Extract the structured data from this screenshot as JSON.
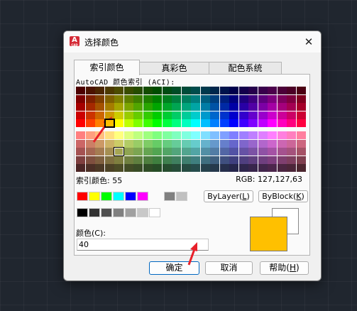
{
  "window": {
    "title": "选择颜色",
    "close_glyph": "✕",
    "app_icon_letter": "A",
    "app_icon_sub": "CAD"
  },
  "tabs": [
    {
      "label": "索引颜色",
      "active": true
    },
    {
      "label": "真彩色",
      "active": false
    },
    {
      "label": "配色系统",
      "active": false
    }
  ],
  "aci": {
    "title": "AutoCAD 颜色索引 (ACI):",
    "index_label": "索引颜色: 55",
    "rgb_label": "RGB:  127,127,63",
    "selected_index": 55,
    "hover_index": 57,
    "top_rows": [
      [
        "#4c0000",
        "#4c1300",
        "#4c2600",
        "#4c3900",
        "#4c4c00",
        "#394c00",
        "#264c00",
        "#134c00",
        "#004c00",
        "#004c13",
        "#004c26",
        "#004c39",
        "#004c4c",
        "#00394c",
        "#00264c",
        "#00134c",
        "#00004c",
        "#13004c",
        "#26004c",
        "#39004c",
        "#4c004c",
        "#4c0039",
        "#4c0026",
        "#4c0013"
      ],
      [
        "#7f0000",
        "#7f1f00",
        "#7f3f00",
        "#7f5f00",
        "#7f7f00",
        "#5f7f00",
        "#3f7f00",
        "#1f7f00",
        "#007f00",
        "#007f1f",
        "#007f3f",
        "#007f5f",
        "#007f7f",
        "#005f7f",
        "#003f7f",
        "#001f7f",
        "#00007f",
        "#1f007f",
        "#3f007f",
        "#5f007f",
        "#7f007f",
        "#7f005f",
        "#7f003f",
        "#7f001f"
      ],
      [
        "#a50000",
        "#a52900",
        "#a55200",
        "#a57c00",
        "#a5a500",
        "#7ca500",
        "#52a500",
        "#29a500",
        "#00a500",
        "#00a529",
        "#00a552",
        "#00a57c",
        "#00a5a5",
        "#007ca5",
        "#0052a5",
        "#0029a5",
        "#0000a5",
        "#2900a5",
        "#5200a5",
        "#7c00a5",
        "#a500a5",
        "#a5007c",
        "#a50052",
        "#a50029"
      ],
      [
        "#cc0000",
        "#cc3300",
        "#cc6600",
        "#cc9900",
        "#cccc00",
        "#99cc00",
        "#66cc00",
        "#33cc00",
        "#00cc00",
        "#00cc33",
        "#00cc66",
        "#00cc99",
        "#00cccc",
        "#0099cc",
        "#0066cc",
        "#0033cc",
        "#0000cc",
        "#3300cc",
        "#6600cc",
        "#9900cc",
        "#cc00cc",
        "#cc0099",
        "#cc0066",
        "#cc0033"
      ],
      [
        "#ff0000",
        "#ff3f00",
        "#ff7f00",
        "#ffbf00",
        "#ffff00",
        "#bfff00",
        "#7fff00",
        "#3fff00",
        "#00ff00",
        "#00ff3f",
        "#00ff7f",
        "#00ffbf",
        "#00ffff",
        "#00bfff",
        "#007fff",
        "#003fff",
        "#0000ff",
        "#3f00ff",
        "#7f00ff",
        "#bf00ff",
        "#ff00ff",
        "#ff00bf",
        "#ff007f",
        "#ff003f"
      ]
    ],
    "bottom_rows": [
      [
        "#ff7f7f",
        "#ff9f7f",
        "#ffbf7f",
        "#ffdf7f",
        "#ffff7f",
        "#dfff7f",
        "#bfff7f",
        "#9fff7f",
        "#7fff7f",
        "#7fff9f",
        "#7fffbf",
        "#7fffdf",
        "#7fffff",
        "#7fdfff",
        "#7fbfff",
        "#7f9fff",
        "#7f7fff",
        "#9f7fff",
        "#bf7fff",
        "#df7fff",
        "#ff7fff",
        "#ff7fdf",
        "#ff7fbf",
        "#ff7f9f"
      ],
      [
        "#cc6666",
        "#cc7f66",
        "#cc9966",
        "#ccb266",
        "#cccc66",
        "#b2cc66",
        "#99cc66",
        "#7fcc66",
        "#66cc66",
        "#66cc7f",
        "#66cc99",
        "#66ccb2",
        "#66cccc",
        "#66b2cc",
        "#6699cc",
        "#667fcc",
        "#6666cc",
        "#7f66cc",
        "#9966cc",
        "#b266cc",
        "#cc66cc",
        "#cc66b2",
        "#cc6699",
        "#cc667f"
      ],
      [
        "#a55252",
        "#a56652",
        "#a57c52",
        "#a58f52",
        "#a5a552",
        "#8fa552",
        "#7ca552",
        "#66a552",
        "#52a552",
        "#52a566",
        "#52a57c",
        "#52a58f",
        "#52a5a5",
        "#528fa5",
        "#527ca5",
        "#5266a5",
        "#5252a5",
        "#6652a5",
        "#7c52a5",
        "#8f52a5",
        "#a552a5",
        "#a5528f",
        "#a5527c",
        "#a55266"
      ],
      [
        "#7f3f3f",
        "#7f4f3f",
        "#7f5f3f",
        "#7f6f3f",
        "#7f7f3f",
        "#6f7f3f",
        "#5f7f3f",
        "#4f7f3f",
        "#3f7f3f",
        "#3f7f4f",
        "#3f7f5f",
        "#3f7f6f",
        "#3f7f7f",
        "#3f6f7f",
        "#3f5f7f",
        "#3f4f7f",
        "#3f3f7f",
        "#4f3f7f",
        "#5f3f7f",
        "#6f3f7f",
        "#7f3f7f",
        "#7f3f6f",
        "#7f3f5f",
        "#7f3f4f"
      ],
      [
        "#4c2626",
        "#4c2f26",
        "#4c3926",
        "#4c4226",
        "#4c4c26",
        "#424c26",
        "#394c26",
        "#2f4c26",
        "#264c26",
        "#264c2f",
        "#264c39",
        "#264c42",
        "#264c4c",
        "#26424c",
        "#26394c",
        "#262f4c",
        "#26264c",
        "#2f264c",
        "#39264c",
        "#42264c",
        "#4c264c",
        "#4c2642",
        "#4c2639",
        "#4c262f"
      ]
    ]
  },
  "standard_colors": [
    "#ff0000",
    "#ffff00",
    "#00ff00",
    "#00ffff",
    "#0000ff",
    "#ff00ff"
  ],
  "gray_pair": [
    "#808080",
    "#c0c0c0"
  ],
  "gray_shades": [
    "#000000",
    "#333333",
    "#505050",
    "#808080",
    "#a0a0a0",
    "#c8c8c8",
    "#ffffff"
  ],
  "buttons": {
    "bylayer": {
      "text": "ByLayer(",
      "key": "L",
      "tail": ")"
    },
    "byblock": {
      "text": "ByBlock(",
      "key": "K",
      "tail": ")"
    },
    "ok": "确定",
    "cancel": "取消",
    "help": {
      "text": "帮助(",
      "key": "H",
      "tail": ")"
    }
  },
  "color_field": {
    "label": "颜色(C):",
    "value": "40"
  },
  "preview": {
    "new_color": "#ffc000",
    "old_color": "#ffffff"
  },
  "annotation_color": "#e8202a"
}
